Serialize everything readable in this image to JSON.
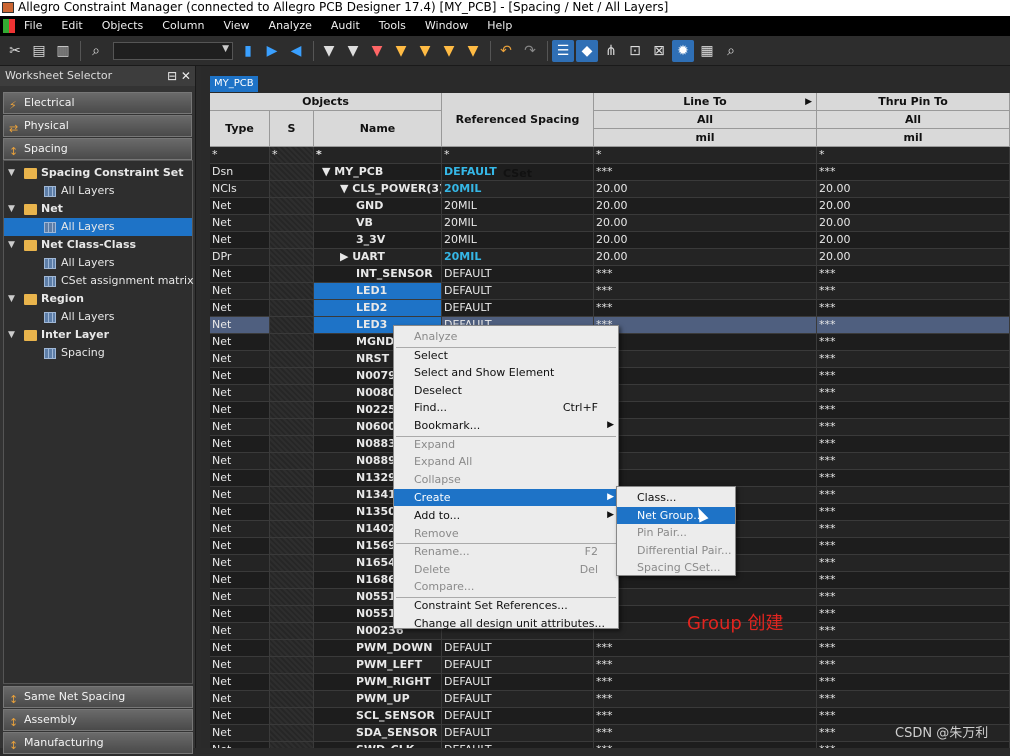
{
  "window": {
    "title": "Allegro Constraint Manager (connected to Allegro PCB Designer 17.4) [MY_PCB] - [Spacing / Net / All Layers]"
  },
  "menubar": [
    "File",
    "Edit",
    "Objects",
    "Column",
    "View",
    "Analyze",
    "Audit",
    "Tools",
    "Window",
    "Help"
  ],
  "sidebar": {
    "title": "Worksheet Selector",
    "categories_top": [
      "Electrical",
      "Physical",
      "Spacing"
    ],
    "tree": [
      {
        "label": "Spacing Constraint Set",
        "level": 0,
        "kind": "folder"
      },
      {
        "label": "All Layers",
        "level": 1,
        "kind": "sheet"
      },
      {
        "label": "Net",
        "level": 0,
        "kind": "folder"
      },
      {
        "label": "All Layers",
        "level": 1,
        "kind": "sheet",
        "selected": true
      },
      {
        "label": "Net Class-Class",
        "level": 0,
        "kind": "folder"
      },
      {
        "label": "All Layers",
        "level": 1,
        "kind": "sheet"
      },
      {
        "label": "CSet assignment matrix",
        "level": 1,
        "kind": "sheet"
      },
      {
        "label": "Region",
        "level": 0,
        "kind": "folder"
      },
      {
        "label": "All Layers",
        "level": 1,
        "kind": "sheet"
      },
      {
        "label": "Inter Layer",
        "level": 0,
        "kind": "folder"
      },
      {
        "label": "Spacing",
        "level": 1,
        "kind": "sheet"
      }
    ],
    "categories_bottom": [
      "Same Net Spacing",
      "Assembly",
      "Manufacturing"
    ]
  },
  "tab": "MY_PCB",
  "table": {
    "headers": {
      "objects": "Objects",
      "type": "Type",
      "s": "S",
      "name": "Name",
      "cset": "Referenced Spacing CSet",
      "line_to": "Line To",
      "thru_pin_to": "Thru Pin To",
      "all": "All",
      "mil": "mil"
    },
    "filter_row": [
      "*",
      "*",
      "*",
      "*",
      "*",
      "*"
    ],
    "rows": [
      [
        "Dsn",
        "▼ MY_PCB",
        "DEFAULT",
        "***",
        "***"
      ],
      [
        "NCls",
        "▼ CLS_POWER(3)",
        "20MIL",
        "20.00",
        "20.00"
      ],
      [
        "Net",
        "GND",
        "20MIL",
        "20.00",
        "20.00"
      ],
      [
        "Net",
        "VB",
        "20MIL",
        "20.00",
        "20.00"
      ],
      [
        "Net",
        "3_3V",
        "20MIL",
        "20.00",
        "20.00"
      ],
      [
        "DPr",
        "▶ UART",
        "20MIL",
        "20.00",
        "20.00"
      ],
      [
        "Net",
        "INT_SENSOR",
        "DEFAULT",
        "***",
        "***"
      ],
      [
        "Net",
        "LED1",
        "DEFAULT",
        "***",
        "***"
      ],
      [
        "Net",
        "LED2",
        "DEFAULT",
        "***",
        "***"
      ],
      [
        "Net",
        "LED3",
        "DEFAULT",
        "***",
        "***"
      ],
      [
        "Net",
        "MGND",
        "",
        "",
        "***"
      ],
      [
        "Net",
        "NRST",
        "",
        "",
        "***"
      ],
      [
        "Net",
        "N00793",
        "",
        "",
        "***"
      ],
      [
        "Net",
        "N00800",
        "",
        "",
        "***"
      ],
      [
        "Net",
        "N02254",
        "",
        "",
        "***"
      ],
      [
        "Net",
        "N06005",
        "",
        "",
        "***"
      ],
      [
        "Net",
        "N08830",
        "",
        "",
        "***"
      ],
      [
        "Net",
        "N08890",
        "",
        "",
        "***"
      ],
      [
        "Net",
        "N13297",
        "",
        "",
        "***"
      ],
      [
        "Net",
        "N13418",
        "",
        "",
        "***"
      ],
      [
        "Net",
        "N13500",
        "",
        "",
        "***"
      ],
      [
        "Net",
        "N14028",
        "",
        "",
        "***"
      ],
      [
        "Net",
        "N15699",
        "",
        "",
        "***"
      ],
      [
        "Net",
        "N16547",
        "",
        "",
        "***"
      ],
      [
        "Net",
        "N16868",
        "",
        "",
        "***"
      ],
      [
        "Net",
        "N05510",
        "",
        "",
        "***"
      ],
      [
        "Net",
        "N05510",
        "",
        "",
        "***"
      ],
      [
        "Net",
        "N00236",
        "",
        "",
        "***"
      ],
      [
        "Net",
        "PWM_DOWN",
        "DEFAULT",
        "***",
        "***"
      ],
      [
        "Net",
        "PWM_LEFT",
        "DEFAULT",
        "***",
        "***"
      ],
      [
        "Net",
        "PWM_RIGHT",
        "DEFAULT",
        "***",
        "***"
      ],
      [
        "Net",
        "PWM_UP",
        "DEFAULT",
        "***",
        "***"
      ],
      [
        "Net",
        "SCL_SENSOR",
        "DEFAULT",
        "***",
        "***"
      ],
      [
        "Net",
        "SDA_SENSOR",
        "DEFAULT",
        "***",
        "***"
      ],
      [
        "Net",
        "SWD_CLK",
        "DEFAULT",
        "***",
        "***"
      ]
    ]
  },
  "context_menu": [
    {
      "label": "Analyze",
      "disabled": true
    },
    {
      "sep": true
    },
    {
      "label": "Select"
    },
    {
      "label": "Select and Show Element"
    },
    {
      "label": "Deselect"
    },
    {
      "label": "Find...",
      "shortcut": "Ctrl+F"
    },
    {
      "label": "Bookmark...",
      "submenu": true
    },
    {
      "sep": true
    },
    {
      "label": "Expand",
      "disabled": true
    },
    {
      "label": "Expand All",
      "disabled": true
    },
    {
      "label": "Collapse",
      "disabled": true
    },
    {
      "sep": true
    },
    {
      "label": "Create",
      "submenu": true,
      "hover": true
    },
    {
      "label": "Add to...",
      "submenu": true
    },
    {
      "label": "Remove",
      "disabled": true
    },
    {
      "sep": true
    },
    {
      "label": "Rename...",
      "shortcut": "F2",
      "disabled": true
    },
    {
      "label": "Delete",
      "shortcut": "Del",
      "disabled": true
    },
    {
      "label": "Compare...",
      "disabled": true
    },
    {
      "sep": true
    },
    {
      "label": "Constraint Set References..."
    },
    {
      "label": "Change all design unit attributes..."
    }
  ],
  "submenu": [
    {
      "label": "Class..."
    },
    {
      "label": "Net Group...",
      "hover": true
    },
    {
      "label": "Pin Pair...",
      "disabled": true
    },
    {
      "label": "Differential Pair...",
      "disabled": true
    },
    {
      "label": "Spacing CSet...",
      "disabled": true
    }
  ],
  "annotation": "Group 创建",
  "watermark": "CSDN @朱万利"
}
